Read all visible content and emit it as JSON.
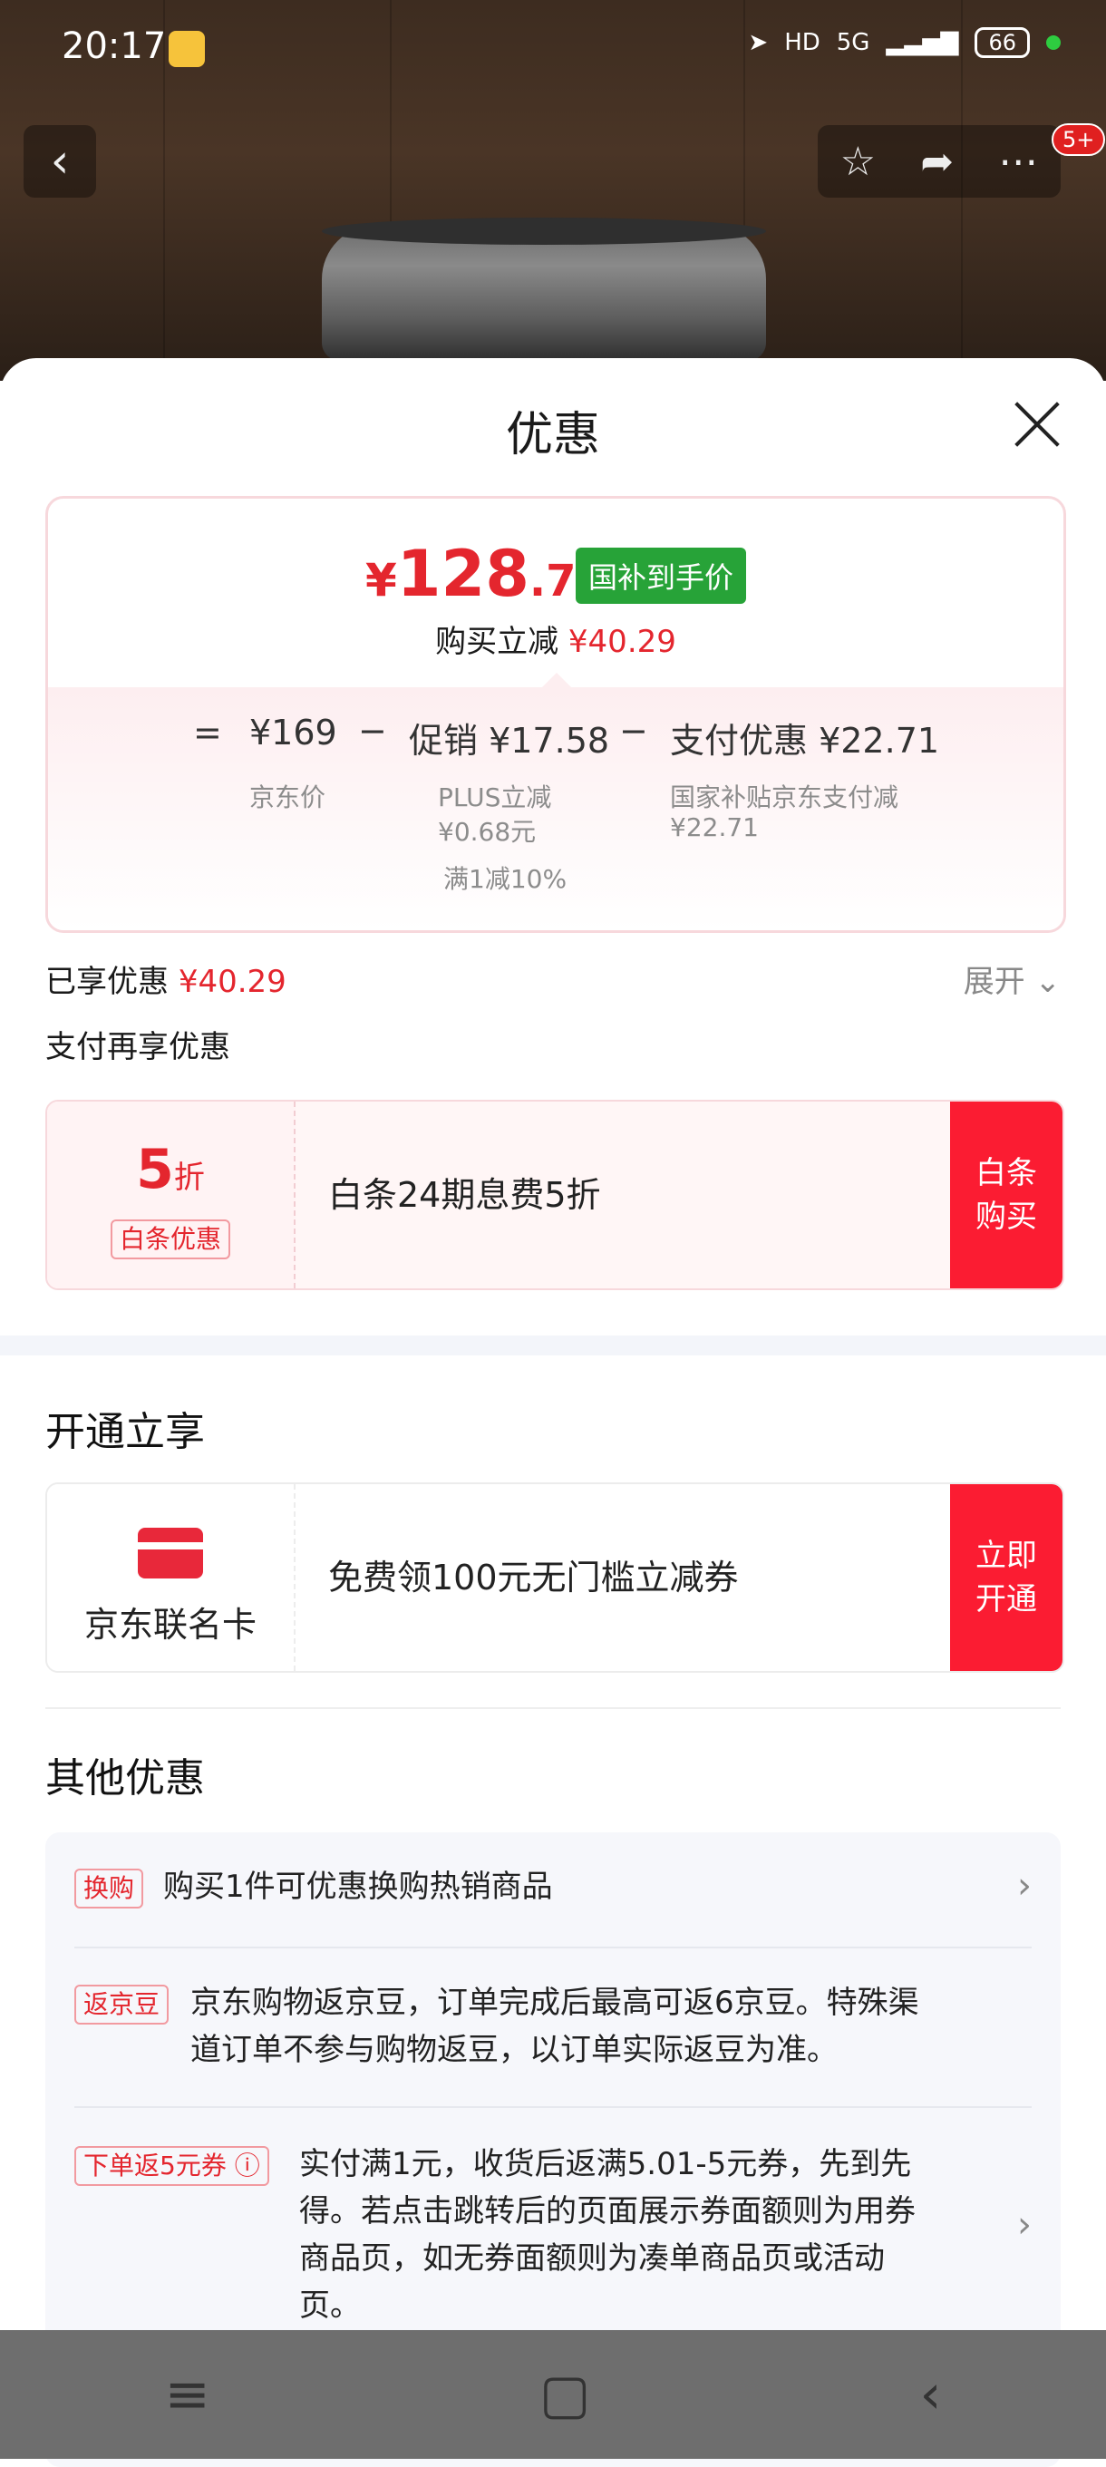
{
  "status_bar": {
    "time": "20:17",
    "hd": "HD",
    "network": "5G",
    "battery": "66"
  },
  "topnav": {
    "badge": "5+"
  },
  "sheet": {
    "title": "优惠",
    "price": {
      "currency": "¥",
      "integer": "128",
      "decimal": ".71",
      "tag": "国补到手价",
      "reduce_label": "购买立减",
      "reduce_amount": "¥40.29",
      "eq": "=",
      "minus": "−",
      "jd_price": "¥169",
      "jd_price_label": "京东价",
      "promo": "促销 ¥17.58",
      "promo_plus": "PLUS立减",
      "promo_plus_value": "¥0.68元",
      "promo_full": "满1减10%",
      "pay_discount": "支付优惠 ¥22.71",
      "pay_desc": "国家补贴京东支付减",
      "pay_value": "¥22.71"
    },
    "enjoyed": {
      "label": "已享优惠",
      "amount": "¥40.29",
      "expand": "展开"
    },
    "pay_more": "支付再享优惠",
    "baitiao": {
      "discount_num": "5",
      "discount_unit": "折",
      "tag": "白条优惠",
      "text": "白条24期息费5折",
      "button": "白条购买"
    },
    "open_title": "开通立享",
    "card_offer": {
      "name": "京东联名卡",
      "text": "免费领100元无门槛立减券",
      "button": "立即开通"
    },
    "other_title": "其他优惠",
    "other": [
      {
        "tag": "换购",
        "text": "购买1件可优惠换购热销商品"
      },
      {
        "tag": "返京豆",
        "text_line1": "京东购物返京豆，订单完成后最高可返6京豆。特殊渠",
        "text_line2": "道订单不参与购物返豆，以订单实际返豆为准。"
      },
      {
        "tag": "下单返5元券 ⓘ",
        "text_line1": "实付满1元，收货后返满5.01-5元券，先到先",
        "text_line2": "得。若点击跳转后的页面展示券面额则为用券",
        "text_line3": "商品页，如无券面额则为凑单商品页或活动",
        "text_line4": "页。"
      }
    ]
  },
  "colors": {
    "accent_red": "#e4262e",
    "button_red": "#fb1c32",
    "green_tag": "#27a338"
  }
}
